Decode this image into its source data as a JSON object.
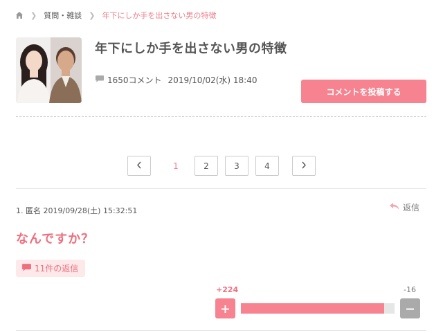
{
  "breadcrumb": {
    "home_icon": "home-icon",
    "items": [
      "質問・雑談",
      "年下にしか手を出さない男の特徴"
    ]
  },
  "topic": {
    "title": "年下にしか手を出さない男の特徴",
    "comment_count": "1650コメント",
    "date": "2019/10/02(水) 18:40",
    "post_button": "コメントを投稿する"
  },
  "pagination": {
    "prev_icon": "chevron-left-icon",
    "next_icon": "chevron-right-icon",
    "pages": [
      "1",
      "2",
      "3",
      "4"
    ],
    "current": "1"
  },
  "comment": {
    "header": "1. 匿名 2019/09/28(土) 15:32:51",
    "reply_label": "返信",
    "body": "なんですか？",
    "replies_label": "11件の返信",
    "plus_votes": "+224",
    "minus_votes": "-16",
    "plus_ratio": 0.933
  },
  "colors": {
    "accent": "#f6838f",
    "accent_text": "#ef6f7e",
    "accent_bg": "#fde9ea",
    "gray_button": "#aaaaaa"
  }
}
